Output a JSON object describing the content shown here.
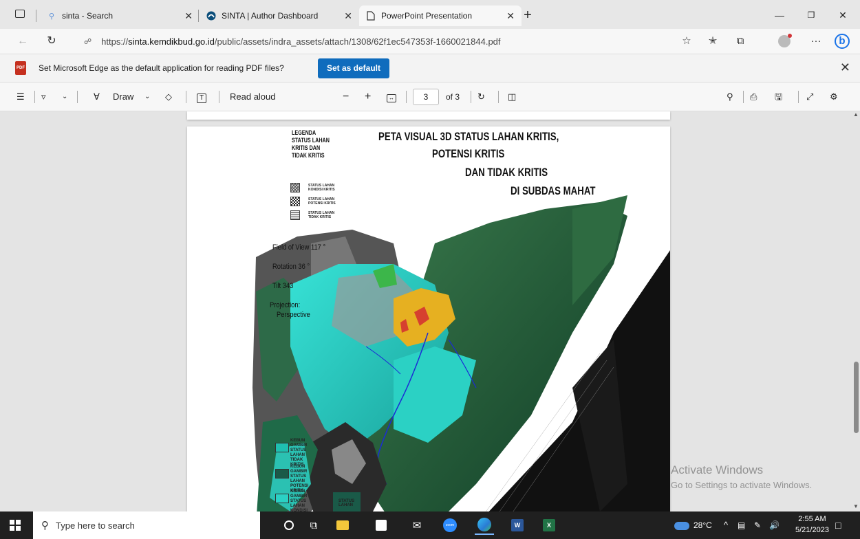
{
  "tabs": [
    {
      "title": "sinta - Search",
      "icon": "search-icon"
    },
    {
      "title": "SINTA | Author Dashboard",
      "icon": "sinta-logo-icon"
    },
    {
      "title": "PowerPoint Presentation",
      "icon": "document-icon"
    }
  ],
  "address": {
    "scheme": "https://",
    "host": "sinta.kemdikbud.go.id",
    "path": "/public/assets/indra_assets/attach/1308/62f1ec547353f-1660021844.pdf"
  },
  "infobar": {
    "message": "Set Microsoft Edge as the default application for reading PDF files?",
    "button": "Set as default"
  },
  "pdf_toolbar": {
    "draw_label": "Draw",
    "read_aloud_label": "Read aloud",
    "current_page": "3",
    "page_total": "of 3"
  },
  "slide": {
    "title_lines": [
      "PETA VISUAL 3D STATUS LAHAN KRITIS,",
      "POTENSI KRITIS",
      "DAN TIDAK KRITIS",
      "DI SUBDAS MAHAT"
    ],
    "legend_title": [
      "LEGENDA",
      "STATUS LAHAN",
      "KRITIS DAN",
      "TIDAK KRITIS"
    ],
    "legend_items": [
      {
        "label": "STATUS LAHAN KONDISI KRITIS"
      },
      {
        "label": "STATUS LAHAN POTENSI KRITIS"
      },
      {
        "label": "STATUS LAHAN TIDAK KRITIS"
      }
    ],
    "params": {
      "field_of_view": "Field of View 117 °",
      "rotation": "Rotation 36 °",
      "tilt": "Tilt 343",
      "projection": "Projection:",
      "perspective": "Perspective"
    },
    "bottom_legend": [
      {
        "label": "KEBUN GAMBIR STATUS LAHAN TIDAK KRITIS",
        "color": "#1fbfb0"
      },
      {
        "label": "KEBUN GAMBIR STATUS LAHAN POTENSI KRITIS",
        "color": "#1a5a48"
      },
      {
        "label": "KEBUN GAMBIR STATUS LAHAN KONDISI KRITIS",
        "color": "#2bd1c4"
      }
    ],
    "bottom_partial": "STATUS LAHAN"
  },
  "watermark": {
    "line1": "Activate Windows",
    "line2": "Go to Settings to activate Windows."
  },
  "taskbar": {
    "search_placeholder": "Type here to search",
    "weather": "28°C",
    "time": "2:55 AM",
    "date": "5/21/2023"
  }
}
